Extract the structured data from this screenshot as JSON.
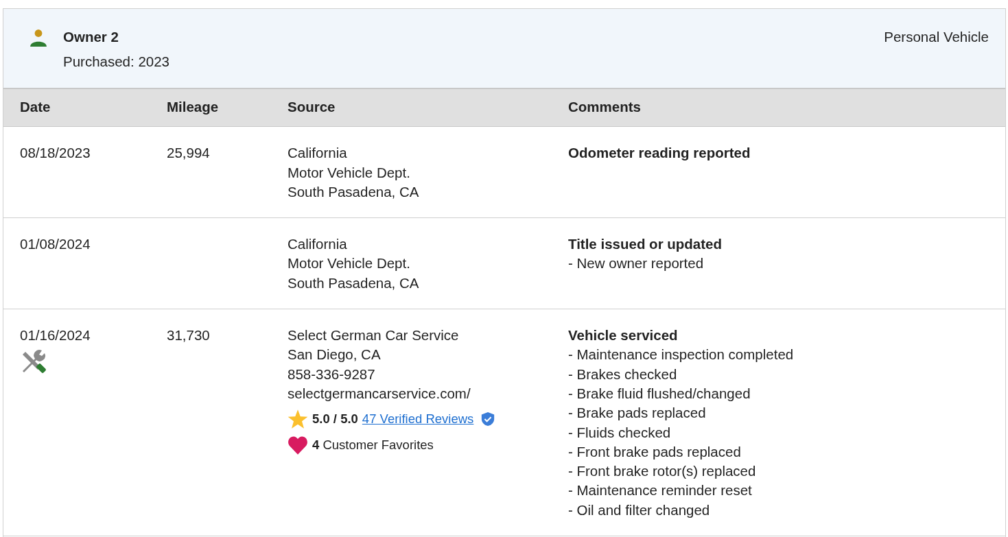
{
  "owner": {
    "name": "Owner 2",
    "purchased": "Purchased: 2023",
    "usage": "Personal Vehicle"
  },
  "table": {
    "columns": [
      "Date",
      "Mileage",
      "Source",
      "Comments"
    ],
    "rows": [
      {
        "date": "08/18/2023",
        "mileage": "25,994",
        "source": [
          "California",
          "Motor Vehicle Dept.",
          "South Pasadena, CA"
        ],
        "comment_title": "Odometer reading reported",
        "comment_items": []
      },
      {
        "date": "01/08/2024",
        "mileage": "",
        "source": [
          "California",
          "Motor Vehicle Dept.",
          "South Pasadena, CA"
        ],
        "comment_title": "Title issued or updated",
        "comment_items": [
          "- New owner reported"
        ]
      },
      {
        "date": "01/16/2024",
        "kind": "service",
        "mileage": "31,730",
        "source": [
          "Select German Car Service",
          "San Diego, CA",
          "858-336-9287",
          "selectgermancarservice.com/"
        ],
        "rating": {
          "score": "5.0 / 5.0",
          "reviews": "47 Verified Reviews",
          "favorites": "**4** Customer Favorites"
        },
        "comment_title": "Vehicle serviced",
        "comment_items": [
          "- Maintenance inspection completed",
          "- Brakes checked",
          "- Brake fluid flushed/changed",
          "- Brake pads replaced",
          "- Fluids checked",
          "- Front brake pads replaced",
          "- Front brake rotor(s) replaced",
          "- Maintenance reminder reset",
          "- Oil and filter changed"
        ]
      }
    ]
  }
}
